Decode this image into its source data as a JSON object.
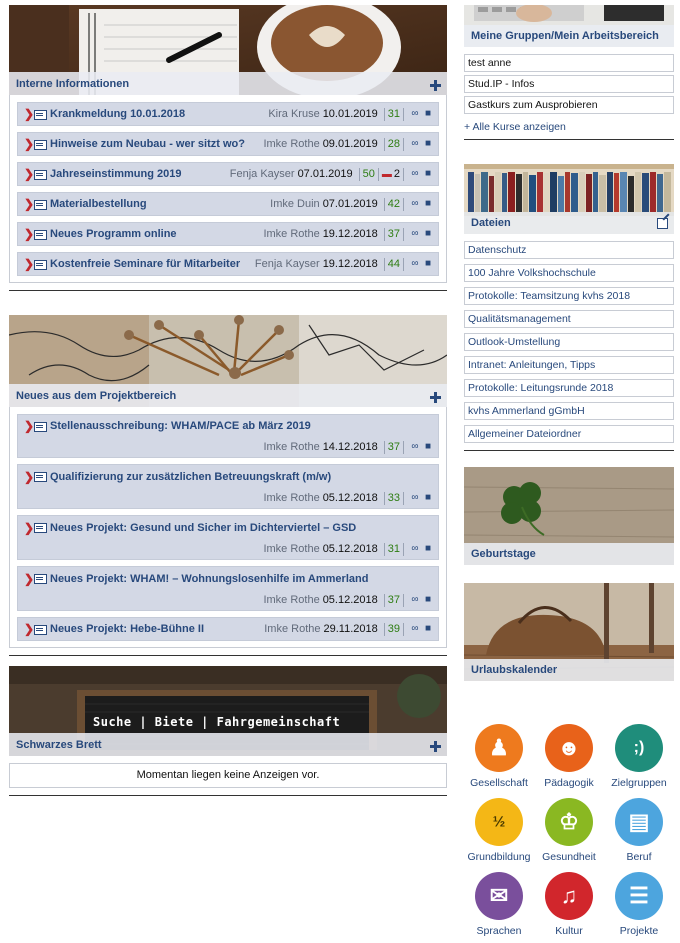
{
  "intern": {
    "title": "Interne Informationen",
    "items": [
      {
        "title": "Krankmeldung 10.01.2018",
        "author": "Kira Kruse",
        "date": "10.01.2019",
        "count": "31",
        "comments": ""
      },
      {
        "title": "Hinweise zum Neubau - wer sitzt wo?",
        "author": "Imke Rothe",
        "date": "09.01.2019",
        "count": "28",
        "comments": ""
      },
      {
        "title": "Jahreseinstimmung 2019",
        "author": "Fenja Kayser",
        "date": "07.01.2019",
        "count": "50",
        "comments": "2"
      },
      {
        "title": "Materialbestellung",
        "author": "Imke Duin",
        "date": "07.01.2019",
        "count": "42",
        "comments": ""
      },
      {
        "title": "Neues Programm online",
        "author": "Imke Rothe",
        "date": "19.12.2018",
        "count": "37",
        "comments": ""
      },
      {
        "title": "Kostenfreie Seminare für Mitarbeiter",
        "author": "Fenja Kayser",
        "date": "19.12.2018",
        "count": "44",
        "comments": ""
      }
    ]
  },
  "projekt": {
    "title": "Neues aus dem Projektbereich",
    "items": [
      {
        "title": "Stellenausschreibung: WHAM/PACE ab März 2019",
        "author": "Imke Rothe",
        "date": "14.12.2018",
        "count": "37"
      },
      {
        "title": "Qualifizierung zur zusätzlichen Betreuungskraft (m/w)",
        "author": "Imke Rothe",
        "date": "05.12.2018",
        "count": "33"
      },
      {
        "title": "Neues Projekt: Gesund und Sicher im Dichterviertel – GSD",
        "author": "Imke Rothe",
        "date": "05.12.2018",
        "count": "31"
      },
      {
        "title": "Neues Projekt: WHAM! – Wohnungslosenhilfe im Ammerland",
        "author": "Imke Rothe",
        "date": "05.12.2018",
        "count": "37"
      },
      {
        "title": "Neues Projekt: Hebe-Bühne II",
        "author": "Imke Rothe",
        "date": "29.11.2018",
        "count": "39"
      }
    ]
  },
  "brett": {
    "title": "Schwarzes Brett",
    "sign": "Suche | Biete | Fahrgemeinschaft",
    "empty": "Momentan liegen keine Anzeigen vor."
  },
  "groups": {
    "title": "Meine Gruppen/Mein Arbeitsbereich",
    "items": [
      "test anne",
      "Stud.IP - Infos",
      "Gastkurs zum Ausprobieren"
    ],
    "all": "+ Alle Kurse anzeigen"
  },
  "files": {
    "title": "Dateien",
    "items": [
      "Datenschutz",
      "100 Jahre Volkshochschule",
      "Protokolle: Teamsitzung kvhs 2018",
      "Qualitätsmanagement",
      "Outlook-Umstellung",
      "Intranet: Anleitungen, Tipps",
      "Protokolle: Leitungsrunde 2018",
      "kvhs Ammerland gGmbH",
      "Allgemeiner Dateiordner"
    ]
  },
  "birthdays": {
    "title": "Geburtstage"
  },
  "vacation": {
    "title": "Urlaubskalender"
  },
  "categories": [
    {
      "label": "Gesellschaft",
      "color": "#ee7a1e",
      "icon": "people-icon"
    },
    {
      "label": "Pädagogik",
      "color": "#e8621a",
      "icon": "head-icon"
    },
    {
      "label": "Zielgruppen",
      "color": "#1f8d7b",
      "icon": "speech-icon"
    },
    {
      "label": "Grundbildung",
      "color": "#f4b716",
      "icon": "book-icon"
    },
    {
      "label": "Gesundheit",
      "color": "#8ab822",
      "icon": "wellness-icon"
    },
    {
      "label": "Beruf",
      "color": "#4da5de",
      "icon": "ladder-icon"
    },
    {
      "label": "Sprachen",
      "color": "#7a4f9c",
      "icon": "chat-icon"
    },
    {
      "label": "Kultur",
      "color": "#d1262c",
      "icon": "music-icon"
    },
    {
      "label": "Projekte",
      "color": "#4da5de",
      "icon": "project-icon"
    }
  ]
}
